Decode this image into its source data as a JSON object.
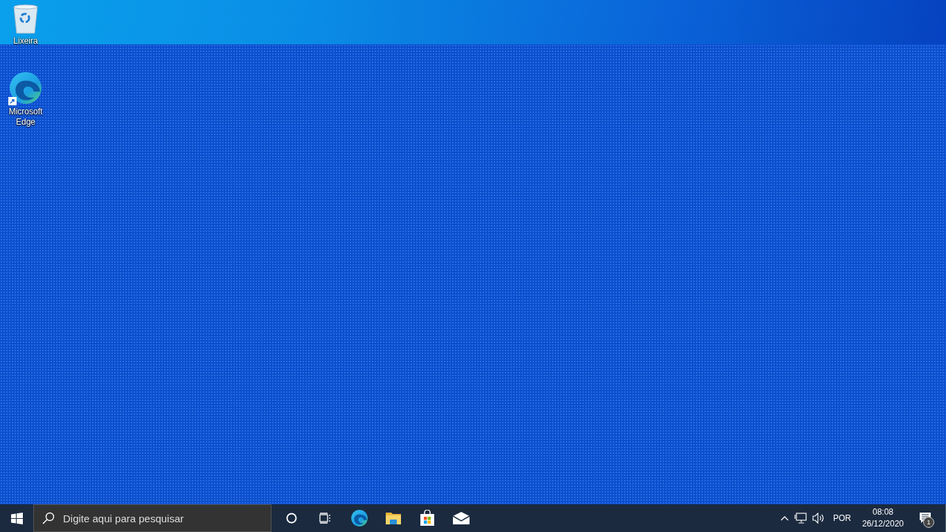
{
  "desktop_icons": [
    {
      "kind": "bin",
      "label": "Lixeira",
      "shortcut": false
    },
    {
      "kind": "browser",
      "label": "Microsoft\nEdge",
      "shortcut": true
    }
  ],
  "taskbar": {
    "search": {
      "placeholder": "Digite aqui para pesquisar"
    },
    "apps": [
      {
        "kind": "circle"
      },
      {
        "kind": "taskview"
      },
      {
        "kind": "browser"
      },
      {
        "kind": "folder"
      },
      {
        "kind": "store"
      },
      {
        "kind": "mail"
      }
    ],
    "tray": {
      "language": "POR",
      "time": "08:08",
      "date": "26/12/2020",
      "notifications": "1"
    }
  }
}
